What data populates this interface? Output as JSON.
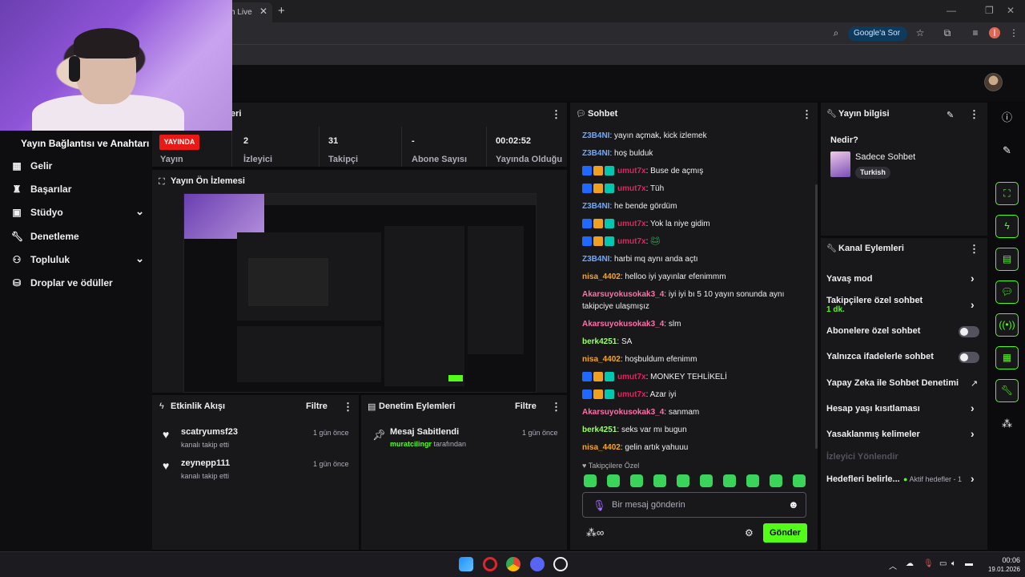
{
  "browser": {
    "tab_title": "h Live",
    "google_sor": "Google'a Sor"
  },
  "nav": {
    "stream_key_title": "Yayın Bağlantısı ve Anahtarı",
    "items": [
      {
        "label": "Gelir",
        "icon": "revenue-icon"
      },
      {
        "label": "Başarılar",
        "icon": "trophy-icon"
      },
      {
        "label": "Stüdyo",
        "icon": "studio-icon",
        "expandable": true
      },
      {
        "label": "Denetleme",
        "icon": "wrench-icon"
      },
      {
        "label": "Topluluk",
        "icon": "community-icon",
        "expandable": true
      },
      {
        "label": "Droplar ve ödüller",
        "icon": "drops-icon"
      }
    ]
  },
  "stats": {
    "panel_title": "eri",
    "live_badge": "YAYINDA",
    "stream_label": "Yayın",
    "viewers_value": "2",
    "viewers_label": "İzleyici",
    "followers_value": "31",
    "followers_label": "Takipçi",
    "subs_value": "-",
    "subs_label": "Abone Sayısı",
    "uptime_value": "00:02:52",
    "uptime_label": "Yayında Olduğu"
  },
  "preview": {
    "title": "Yayın Ön İzlemesi"
  },
  "activity": {
    "title": "Etkinlik Akışı",
    "filter": "Filtre",
    "events": [
      {
        "name": "scatryumsf23",
        "sub": "kanalı takip etti",
        "time": "1 gün önce"
      },
      {
        "name": "zeynepp111",
        "sub": "kanalı takip etti",
        "time": "1 gün önce"
      }
    ]
  },
  "moderation": {
    "title": "Denetim Eylemleri",
    "filter": "Filtre",
    "events": [
      {
        "name": "Mesaj Sabitlendi",
        "user": "muratcilingr",
        "sub": "tarafından",
        "time": "1 gün önce"
      }
    ]
  },
  "chat": {
    "title": "Sohbet",
    "messages": [
      {
        "user": "Z3B4NI",
        "color": "#6fa8ff",
        "text": "yayın açmak, kick izlemek",
        "badges": false
      },
      {
        "user": "Z3B4NI",
        "color": "#6fa8ff",
        "text": "hoş bulduk",
        "badges": false
      },
      {
        "user": "umut7x",
        "color": "#e0245e",
        "text": "Buse de açmış",
        "badges": true
      },
      {
        "user": "umut7x",
        "color": "#e0245e",
        "text": "Tüh",
        "badges": true
      },
      {
        "user": "Z3B4NI",
        "color": "#6fa8ff",
        "text": "he bende gördüm",
        "badges": false
      },
      {
        "user": "umut7x",
        "color": "#e0245e",
        "text": "Yok la niye gidim",
        "badges": true
      },
      {
        "user": "umut7x",
        "color": "#e0245e",
        "text": "",
        "badges": true
      },
      {
        "user": "Z3B4NI",
        "color": "#6fa8ff",
        "text": "harbi mq aynı anda açtı",
        "badges": false
      },
      {
        "user": "nisa_4402",
        "color": "#f5a623",
        "text": "helloo iyi yayınlar efenimmm",
        "badges": false
      },
      {
        "user": "Akarsuyokusokak3_4",
        "color": "#ff6fa8",
        "text": "iyi iyi bı 5 10 yayın sonunda aynı takipciye ulaşmışız",
        "badges": false
      },
      {
        "user": "Akarsuyokusokak3_4",
        "color": "#ff6fa8",
        "text": "slm",
        "badges": false
      },
      {
        "user": "berk4251",
        "color": "#9cff6a",
        "text": "SA",
        "badges": false
      },
      {
        "user": "nisa_4402",
        "color": "#f5a623",
        "text": "hoşbuldum efenimm",
        "badges": false
      },
      {
        "user": "umut7x",
        "color": "#e0245e",
        "text": "MONKEY TEHLİKELİ",
        "badges": true
      },
      {
        "user": "umut7x",
        "color": "#e0245e",
        "text": "Azar iyi",
        "badges": true
      },
      {
        "user": "Akarsuyokusokak3_4",
        "color": "#ff6fa8",
        "text": "sanmam",
        "badges": false
      },
      {
        "user": "berk4251",
        "color": "#9cff6a",
        "text": "seks var mı bugun",
        "badges": false
      },
      {
        "user": "nisa_4402",
        "color": "#f5a623",
        "text": "gelin artık yahuuu",
        "badges": false
      }
    ],
    "followers_only_label": "Takipçilere Özel",
    "input_placeholder": "Bir mesaj gönderin",
    "send_label": "Gönder"
  },
  "stream_info": {
    "title": "Yayın bilgisi",
    "heading": "Nedir?",
    "category": "Sadece Sohbet",
    "language": "Turkish"
  },
  "channel_actions": {
    "title": "Kanal Eylemleri",
    "slow_mode": "Yavaş mod",
    "followers_only": "Takipçilere özel sohbet",
    "followers_only_sub": "1 dk.",
    "subs_only": "Abonelere özel sohbet",
    "emotes_only": "Yalnızca ifadelerle sohbet",
    "ai_moderation": "Yapay Zeka ile Sohbet Denetimi",
    "account_age": "Hesap yaşı kısıtlaması",
    "banned_words": "Yasaklanmış kelimeler",
    "redirect": "İzleyici Yönlendir",
    "goals": "Hedefleri belirle...",
    "goals_status": "Aktif hedefler - 1"
  },
  "taskbar": {
    "time": "00:06",
    "date": "19.01.2026"
  },
  "colors": {
    "accent": "#53fc18",
    "live": "#e91916",
    "panel": "#18181b",
    "bg": "#0b0b0d"
  }
}
